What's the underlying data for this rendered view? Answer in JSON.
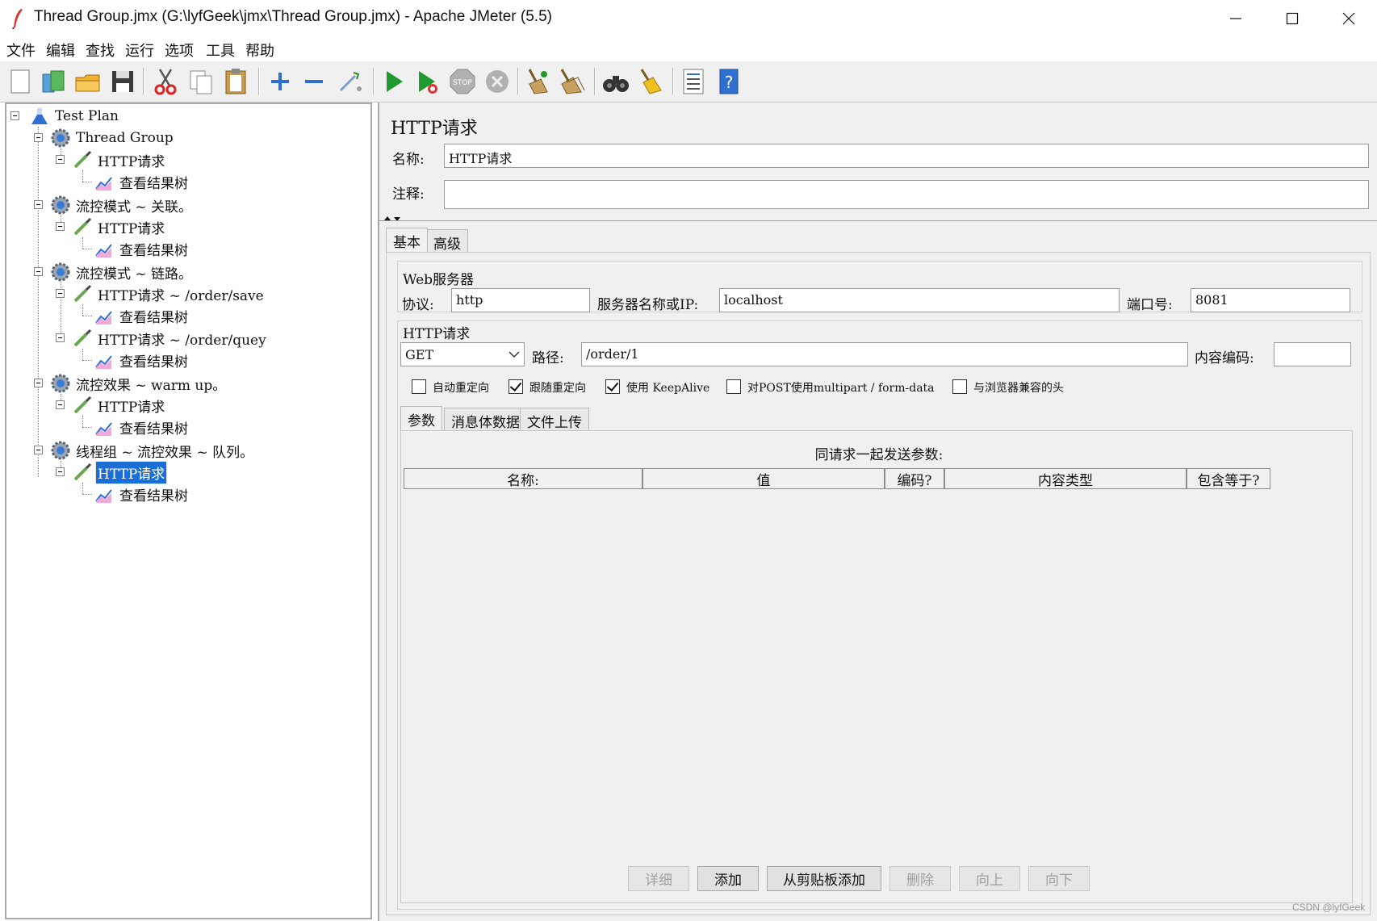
{
  "window": {
    "title": "Thread Group.jmx (G:\\lyfGeek\\jmx\\Thread Group.jmx) - Apache JMeter (5.5)"
  },
  "menu": [
    "文件",
    "编辑",
    "查找",
    "运行",
    "选项",
    "工具",
    "帮助"
  ],
  "toolbar_icons": [
    "new-icon",
    "templates-icon",
    "open-icon",
    "save-icon",
    "cut-icon",
    "copy-icon",
    "paste-icon",
    "expand-icon",
    "collapse-icon",
    "toggle-icon",
    "start-icon",
    "start-no-pauses-icon",
    "stop-icon",
    "shutdown-icon",
    "clear-icon",
    "clear-all-icon",
    "search-icon",
    "reset-search-icon",
    "function-helper-icon",
    "help-icon"
  ],
  "tree": {
    "items": [
      {
        "label": "Test Plan"
      },
      {
        "label": "Thread Group"
      },
      {
        "label": "HTTP请求"
      },
      {
        "label": "查看结果树"
      },
      {
        "label": "流控模式 ~ 关联。"
      },
      {
        "label": "HTTP请求"
      },
      {
        "label": "查看结果树"
      },
      {
        "label": "流控模式 ~ 链路。"
      },
      {
        "label": "HTTP请求 ~ /order/save"
      },
      {
        "label": "查看结果树"
      },
      {
        "label": "HTTP请求 ~ /order/quey"
      },
      {
        "label": "查看结果树"
      },
      {
        "label": "流控效果 ~ warm up。"
      },
      {
        "label": "HTTP请求"
      },
      {
        "label": "查看结果树"
      },
      {
        "label": "线程组 ~ 流控效果 ~ 队列。"
      },
      {
        "label": "HTTP请求"
      },
      {
        "label": "查看结果树"
      }
    ]
  },
  "panel": {
    "title": "HTTP请求",
    "name_label": "名称:",
    "name_value": "HTTP请求",
    "comment_label": "注释:",
    "comment_value": "",
    "tabs": [
      "基本",
      "高级"
    ],
    "web_server": {
      "title": "Web服务器",
      "protocol_label": "协议:",
      "protocol_value": "http",
      "server_label": "服务器名称或IP:",
      "server_value": "localhost",
      "port_label": "端口号:",
      "port_value": "8081"
    },
    "http_request": {
      "title": "HTTP请求",
      "method_value": "GET",
      "path_label": "路径:",
      "path_value": "/order/1",
      "encoding_label": "内容编码:",
      "encoding_value": ""
    },
    "options": [
      {
        "label": "自动重定向",
        "checked": false
      },
      {
        "label": "跟随重定向",
        "checked": true
      },
      {
        "label": "使用 KeepAlive",
        "checked": true
      },
      {
        "label": "对POST使用multipart / form-data",
        "checked": false
      },
      {
        "label": "与浏览器兼容的头",
        "checked": false
      }
    ],
    "sub_tabs": [
      "参数",
      "消息体数据",
      "文件上传"
    ],
    "params_caption": "同请求一起发送参数:",
    "columns": [
      "名称:",
      "值",
      "编码?",
      "内容类型",
      "包含等于?"
    ],
    "buttons": [
      {
        "label": "详细",
        "enabled": false
      },
      {
        "label": "添加",
        "enabled": true
      },
      {
        "label": "从剪贴板添加",
        "enabled": true
      },
      {
        "label": "删除",
        "enabled": false
      },
      {
        "label": "向上",
        "enabled": false
      },
      {
        "label": "向下",
        "enabled": false
      }
    ]
  },
  "watermark": "CSDN @lyfGeek",
  "colors": {
    "selection": "#1a6fd6",
    "start_green": "#1e9a2e",
    "help_blue": "#2f6fd0"
  }
}
